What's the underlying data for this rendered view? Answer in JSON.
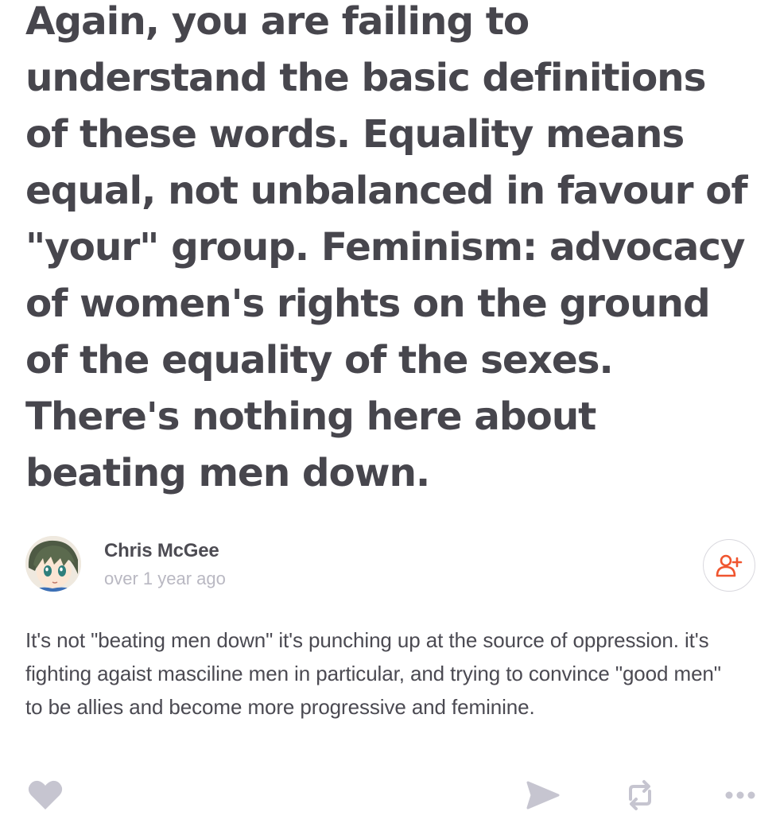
{
  "post": {
    "quote_text": "Again, you are failing to understand the basic definitions of these words. Equality means equal, not unbalanced in favour of \"your\" group. Feminism: advocacy of women's rights on the ground of the equality of the sexes. There's nothing here about beating men down."
  },
  "author": {
    "name": "Chris McGee",
    "time": "over 1 year ago",
    "avatar_icon": "anime-avatar",
    "follow_icon": "add-user-icon"
  },
  "reply": {
    "body": "It's not \"beating men down\" it's punching up at the source of oppression. it's fighting agaist masciline men in particular, and trying to convince \"good men\" to be allies and become more progressive and feminine."
  },
  "actions": {
    "like_icon": "heart-icon",
    "share_icon": "send-icon",
    "repost_icon": "repost-icon",
    "more_icon": "more-icon"
  },
  "colors": {
    "text_primary": "#47464d",
    "text_muted": "#b9b8c2",
    "icon_gray": "#c6c5d0",
    "accent_orange": "#f0552f"
  }
}
